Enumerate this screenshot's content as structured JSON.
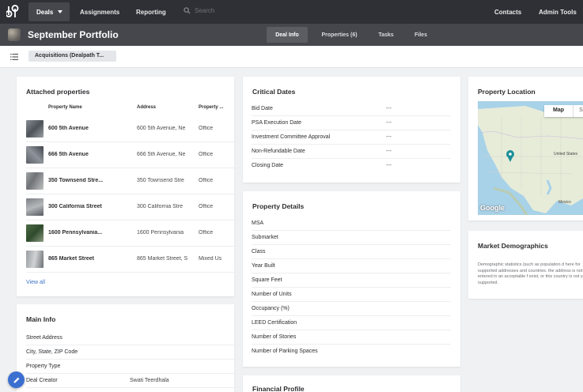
{
  "nav": {
    "deals": "Deals",
    "assignments": "Assignments",
    "reporting": "Reporting",
    "search_placeholder": "Search",
    "contacts": "Contacts",
    "admin_tools": "Admin Tools"
  },
  "header": {
    "title": "September Portfolio",
    "tabs": [
      "Deal Info",
      "Properties (6)",
      "Tasks",
      "Files"
    ]
  },
  "breadcrumb": {
    "label": "Acquisitions (Dealpath T..."
  },
  "attached": {
    "title": "Attached properties",
    "columns": [
      "Property Name",
      "Address",
      "Property ..."
    ],
    "rows": [
      {
        "name": "600 5th Avenue",
        "address": "600 5th Avenue, Ne",
        "type": "Office"
      },
      {
        "name": "666 5th Avenue",
        "address": "666 5th Avenue, Ne",
        "type": "Office"
      },
      {
        "name": "350 Townsend Stre...",
        "address": "350 Townsend Stre",
        "type": "Office"
      },
      {
        "name": "300 California Street",
        "address": "300 California Stre",
        "type": "Office"
      },
      {
        "name": "1600 Pennsylvania...",
        "address": "1600 Pennsylvania",
        "type": "Office"
      },
      {
        "name": "865 Market Street",
        "address": "865 Market Street, S",
        "type": "Mixed Us"
      }
    ],
    "view_all": "View all"
  },
  "main_info": {
    "title": "Main Info",
    "rows": [
      {
        "label": "Street Address",
        "value": ""
      },
      {
        "label": "City, State, ZIP Code",
        "value": ""
      },
      {
        "label": "Property Type",
        "value": ""
      },
      {
        "label": "Deal Creator",
        "value": "Swati Teerdhala"
      }
    ]
  },
  "critical_dates": {
    "title": "Critical Dates",
    "rows": [
      {
        "label": "Bid Date",
        "value": "---"
      },
      {
        "label": "PSA Execution Date",
        "value": "---"
      },
      {
        "label": "Investment Committee Approval",
        "value": "---"
      },
      {
        "label": "Non-Refundable Date",
        "value": "---"
      },
      {
        "label": "Closing Date",
        "value": "---"
      }
    ]
  },
  "property_details": {
    "title": "Property Details",
    "rows": [
      "MSA",
      "Submarket",
      "Class",
      "Year Built",
      "Square Feet",
      "Number of Units",
      "Occupancy (%)",
      "LEED Certification",
      "Number of Stories",
      "Number of Parking Spaces"
    ]
  },
  "financial_profile": {
    "title": "Financial Profile"
  },
  "property_location": {
    "title": "Property Location",
    "map_btn": "Map",
    "sat_btn": "S",
    "google": "Google",
    "label_united_states": "United States",
    "label_mexico": "Mexico"
  },
  "market_demographics": {
    "title": "Market Demographics",
    "text": "Demographic statistics (such as population d here for supported addresses and countries. the address is not entered in an acceptable f exist, or this country is not yet supported."
  },
  "colors": {
    "topnav": "#2e3035",
    "subheader": "#45474d",
    "link": "#3b72c8",
    "fab": "#3a6fd0"
  }
}
